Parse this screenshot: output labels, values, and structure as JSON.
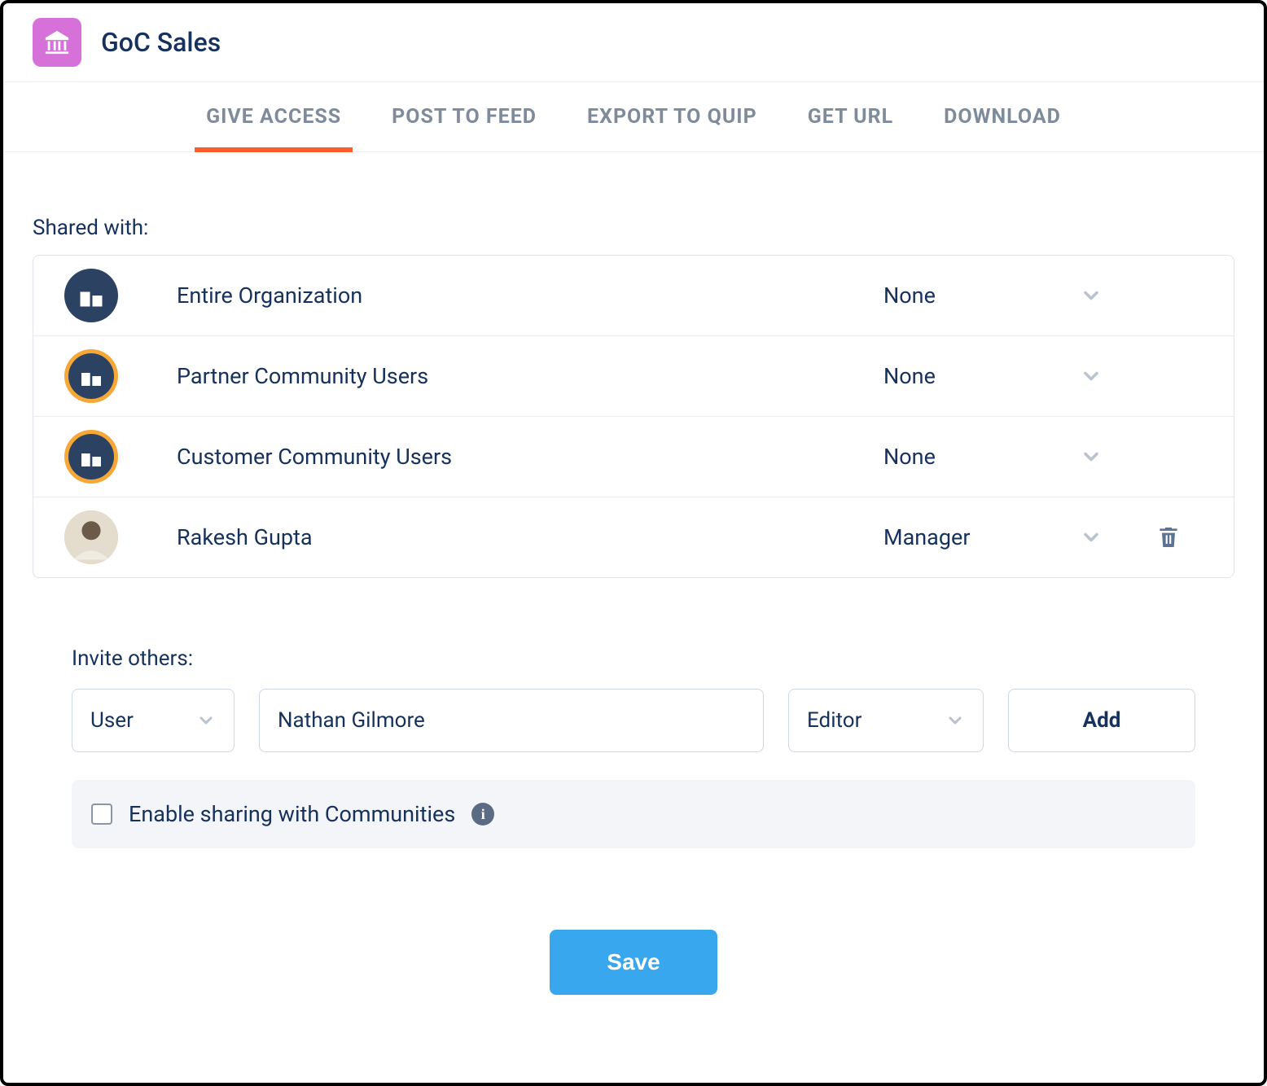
{
  "header": {
    "title": "GoC Sales"
  },
  "tabs": [
    {
      "label": "GIVE ACCESS",
      "active": true
    },
    {
      "label": "POST TO FEED",
      "active": false
    },
    {
      "label": "EXPORT TO QUIP",
      "active": false
    },
    {
      "label": "GET URL",
      "active": false
    },
    {
      "label": "DOWNLOAD",
      "active": false
    }
  ],
  "shared_with_label": "Shared with:",
  "shared_with": [
    {
      "name": "Entire Organization",
      "permission": "None",
      "icon": "org",
      "deletable": false
    },
    {
      "name": "Partner Community Users",
      "permission": "None",
      "icon": "community",
      "deletable": false
    },
    {
      "name": "Customer Community Users",
      "permission": "None",
      "icon": "community",
      "deletable": false
    },
    {
      "name": "Rakesh Gupta",
      "permission": "Manager",
      "icon": "user",
      "deletable": true
    }
  ],
  "invite": {
    "label": "Invite others:",
    "type": "User",
    "name": "Nathan Gilmore",
    "role": "Editor",
    "add_label": "Add"
  },
  "enable": {
    "label": "Enable sharing with Communities",
    "checked": false
  },
  "save_label": "Save",
  "colors": {
    "accent_tab": "#ff5d2d",
    "primary_button": "#39a7ed",
    "app_icon": "#d571d9"
  }
}
